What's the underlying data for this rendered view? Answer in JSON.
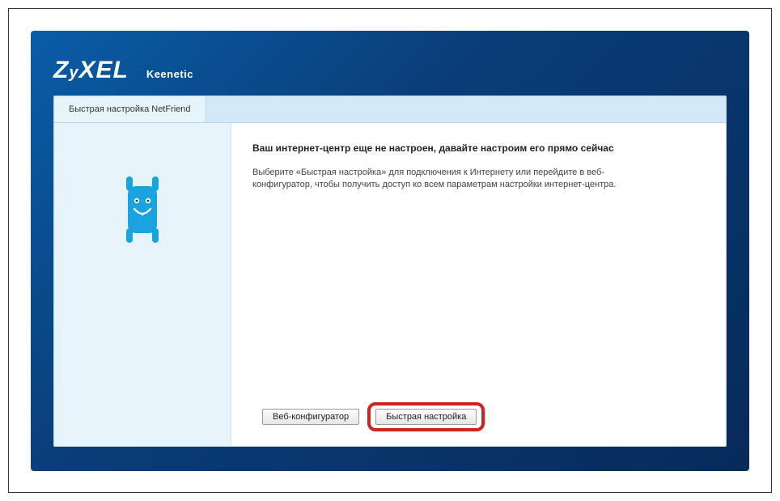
{
  "header": {
    "logo_text": "ZyXEL",
    "product_name": "Keenetic"
  },
  "tabs": {
    "quick_setup": "Быстрая настройка NetFriend"
  },
  "main": {
    "headline": "Ваш интернет-центр еще не настроен, давайте настроим его прямо сейчас",
    "description": "Выберите «Быстрая настройка» для подключения к Интернету или перейдите в веб-конфигуратор, чтобы получить доступ ко всем параметрам настройки интернет-центра."
  },
  "buttons": {
    "web_configurator": "Веб-конфигуратор",
    "quick_setup": "Быстрая настройка"
  },
  "colors": {
    "accent": "#1ba3e0",
    "highlight": "#d32020"
  }
}
